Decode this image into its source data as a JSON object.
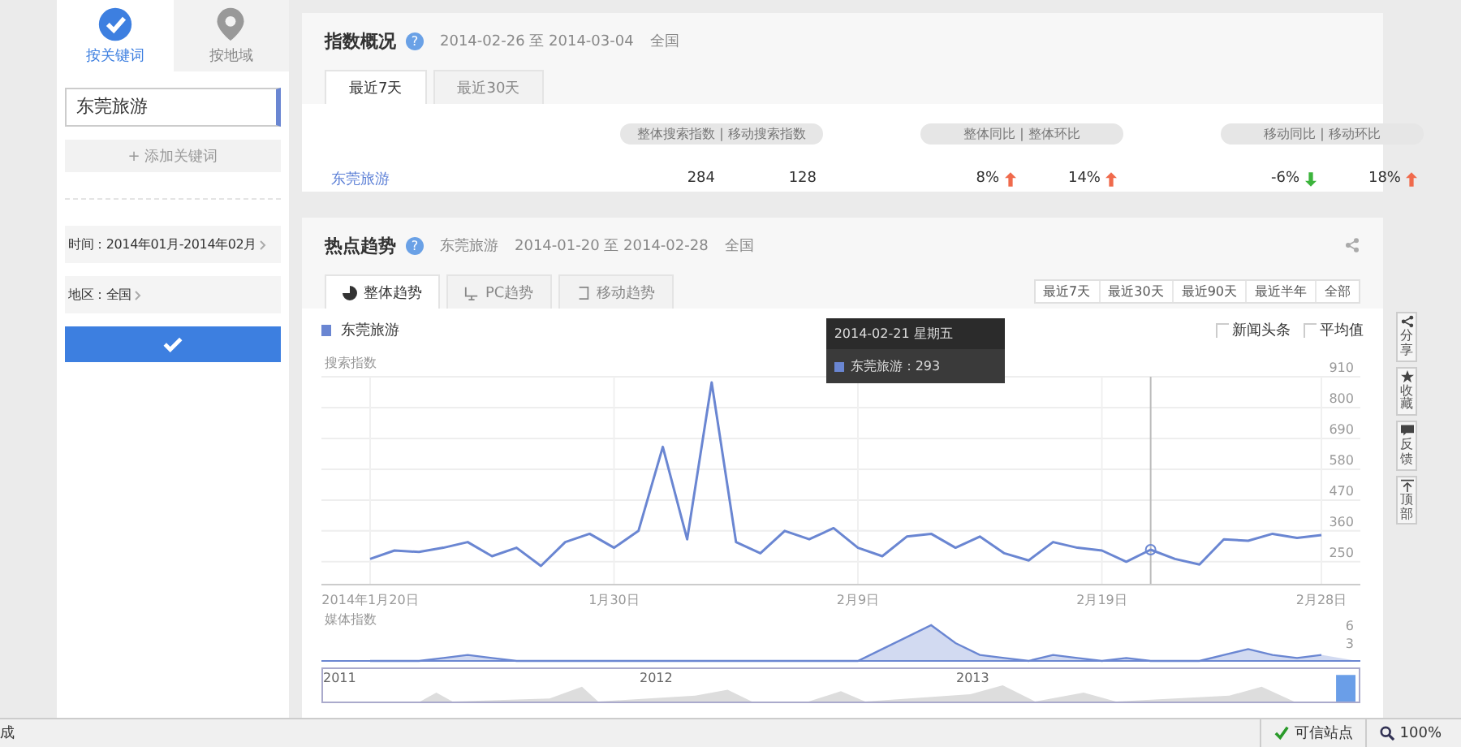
{
  "sidebar": {
    "tabs": [
      {
        "label": "按关键词",
        "selected": true
      },
      {
        "label": "按地域",
        "selected": false
      }
    ],
    "keyword_input": {
      "value": "东莞旅游"
    },
    "add_keyword": "+ 添加关键词",
    "time_filter": "时间：2014年01月-2014年02月",
    "region_filter": "地区：全国"
  },
  "overview": {
    "title": "指数概况",
    "help": "?",
    "date_range": "2014-02-26 至 2014-03-04",
    "region": "全国",
    "tabs": [
      {
        "label": "最近7天",
        "selected": true
      },
      {
        "label": "最近30天",
        "selected": false
      }
    ],
    "column_groups": [
      "整体搜索指数 | 移动搜索指数",
      "整体同比 | 整体环比",
      "移动同比 | 移动环比"
    ],
    "rows": [
      {
        "keyword": "东莞旅游",
        "cells": [
          {
            "value": "284"
          },
          {
            "value": "128"
          },
          {
            "value": "8%",
            "rising": true
          },
          {
            "value": "14%",
            "rising": true
          },
          {
            "value": "-6%",
            "rising": false
          },
          {
            "value": "18%",
            "rising": true
          }
        ]
      }
    ]
  },
  "trend": {
    "title": "热点趋势",
    "help": "?",
    "keyword": "东莞旅游",
    "date_range": "2014-01-20 至 2014-02-28",
    "region": "全国",
    "tabs": [
      {
        "label": "整体趋势",
        "selected": true
      },
      {
        "label": "PC趋势",
        "selected": false
      },
      {
        "label": "移动趋势",
        "selected": false
      }
    ],
    "ranges": [
      {
        "label": "最近7天",
        "selected": false
      },
      {
        "label": "最近30天",
        "selected": false
      },
      {
        "label": "最近90天",
        "selected": false
      },
      {
        "label": "最近半年",
        "selected": false
      },
      {
        "label": "全部",
        "selected": false
      }
    ],
    "options": [
      {
        "label": "新闻头条",
        "checked": false
      },
      {
        "label": "平均值",
        "checked": false
      }
    ],
    "tooltip": {
      "date": "2014-02-21 星期五",
      "label": "东莞旅游：293"
    },
    "chart_data": {
      "type": "line",
      "ylabel": "搜索指数",
      "categories": [
        "2014年1月20日",
        null,
        null,
        null,
        null,
        null,
        null,
        null,
        null,
        null,
        "1月30日",
        null,
        null,
        null,
        null,
        null,
        null,
        null,
        null,
        null,
        "2月9日",
        null,
        null,
        null,
        null,
        null,
        null,
        null,
        null,
        null,
        "2月19日",
        null,
        null,
        null,
        null,
        null,
        null,
        null,
        null,
        "2月28日"
      ],
      "series": [
        {
          "name": "东莞旅游",
          "color": "#6a86d2",
          "values": [
            260,
            290,
            285,
            300,
            320,
            270,
            300,
            235,
            320,
            350,
            300,
            360,
            660,
            330,
            890,
            320,
            280,
            360,
            330,
            370,
            300,
            270,
            340,
            350,
            300,
            340,
            280,
            255,
            320,
            300,
            290,
            250,
            293,
            260,
            240,
            330,
            325,
            350,
            335,
            345
          ]
        }
      ],
      "ylim": [
        180,
        910
      ],
      "yticks": [
        250,
        360,
        470,
        580,
        690,
        800,
        910
      ],
      "grid": true
    },
    "media_chart": {
      "label": "媒体指数",
      "ticks": [
        "6",
        "3"
      ]
    },
    "navigator_years": [
      "2011",
      "2012",
      "2013"
    ]
  },
  "side_tools": [
    {
      "label": "分享"
    },
    {
      "label": "收藏"
    },
    {
      "label": "反馈"
    },
    {
      "label": "顶部"
    }
  ],
  "status_bar": {
    "status": "成",
    "zone": "可信站点",
    "zoom": "100%"
  }
}
